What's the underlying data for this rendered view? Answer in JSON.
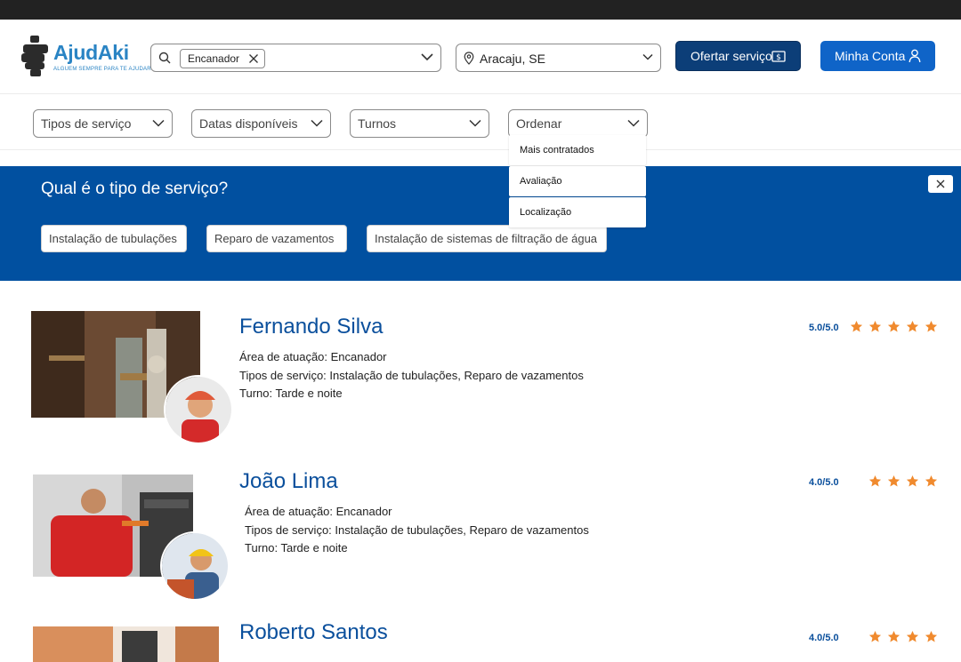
{
  "brand": {
    "name": "AjudAki",
    "tagline": "ALGUEM SEMPRE PARA TE AJUDAR",
    "colors": {
      "primary": "#0150a0",
      "dark": "#0c3e78",
      "button": "#0f64c8",
      "star": "#f08a2e"
    }
  },
  "search": {
    "icon": "search-icon",
    "chip_label": "Encanador",
    "location": "Aracaju, SE"
  },
  "header": {
    "offer_label": "Ofertar serviço",
    "account_label": "Minha Conta"
  },
  "filters": [
    {
      "label": "Tipos de serviço"
    },
    {
      "label": "Datas disponíveis"
    },
    {
      "label": "Turnos"
    },
    {
      "label": "Ordenar"
    }
  ],
  "sort_dropdown": {
    "options": [
      "Mais contratados",
      "Avaliação",
      "Localização"
    ]
  },
  "banner": {
    "title": "Qual é o tipo de serviço?",
    "chips": [
      "Instalação de tubulações",
      "Reparo de vazamentos",
      "Instalação de sistemas de filtração de água"
    ]
  },
  "listings": [
    {
      "name": "Fernando Silva",
      "area": "Área de atuação: Encanador",
      "types": "Tipos de serviço: Instalação de tubulações, Reparo de vazamentos",
      "shift": "Turno: Tarde e noite",
      "rating_text": "5.0/5.0",
      "stars": 5
    },
    {
      "name": "João Lima",
      "area": "Área de atuação: Encanador",
      "types": "Tipos de serviço: Instalação de tubulações, Reparo de vazamentos",
      "shift": "Turno: Tarde e noite",
      "rating_text": "4.0/5.0",
      "stars": 4
    },
    {
      "name": "Roberto Santos",
      "rating_text": "4.0/5.0",
      "stars": 4
    }
  ]
}
